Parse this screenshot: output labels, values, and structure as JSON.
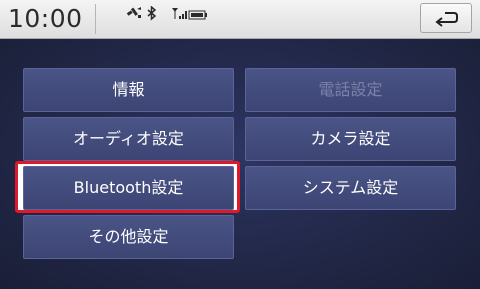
{
  "status": {
    "time": "10:00",
    "icons": [
      "gps-icon",
      "bluetooth-icon",
      "signal-icon",
      "battery-icon"
    ]
  },
  "header": {
    "back_icon": "back-arrow-icon"
  },
  "menu": {
    "items": [
      {
        "label": "情報",
        "enabled": true
      },
      {
        "label": "電話設定",
        "enabled": false
      },
      {
        "label": "オーディオ設定",
        "enabled": true
      },
      {
        "label": "カメラ設定",
        "enabled": true
      },
      {
        "label": "Bluetooth設定",
        "enabled": true,
        "selected": true
      },
      {
        "label": "システム設定",
        "enabled": true
      },
      {
        "label": "その他設定",
        "enabled": true
      }
    ]
  },
  "colors": {
    "selection": "#e0182a",
    "button": "#434c7d",
    "background": "#222848"
  }
}
